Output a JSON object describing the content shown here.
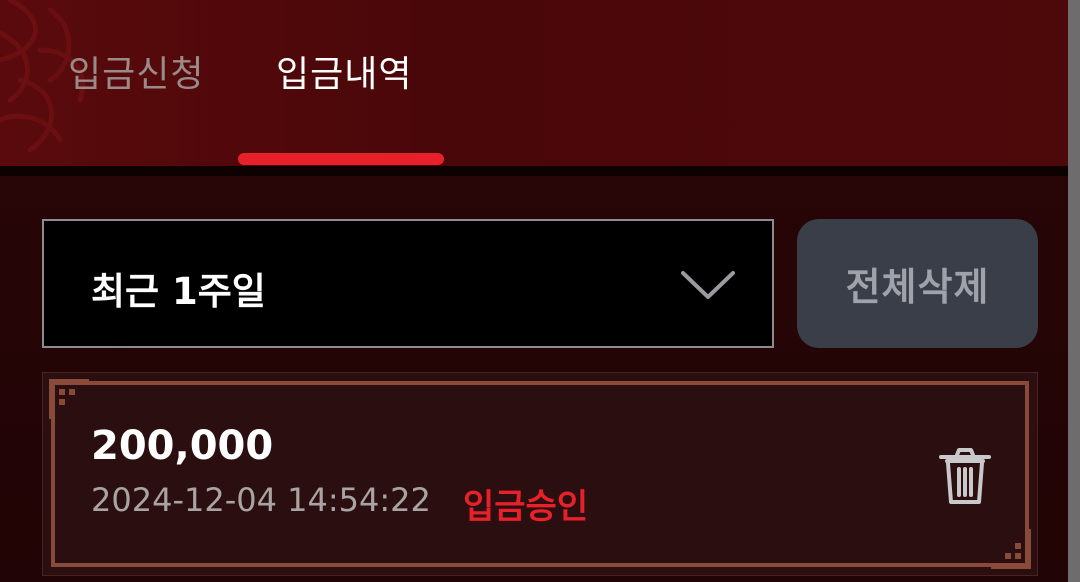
{
  "tabs": {
    "apply_label": "입금신청",
    "history_label": "입금내역",
    "active": "history"
  },
  "filter": {
    "period_value": "최근 1주일",
    "delete_all_label": "전체삭제"
  },
  "records": [
    {
      "amount": "200,000",
      "datetime": "2024-12-04 14:54:22",
      "status": "입금승인"
    }
  ],
  "icons": {
    "dropdown": "chevron-down-icon",
    "delete": "trash-icon"
  },
  "colors": {
    "accent_red": "#e8202a",
    "header_bg": "#4a0709",
    "button_bg": "#3a3e48"
  }
}
